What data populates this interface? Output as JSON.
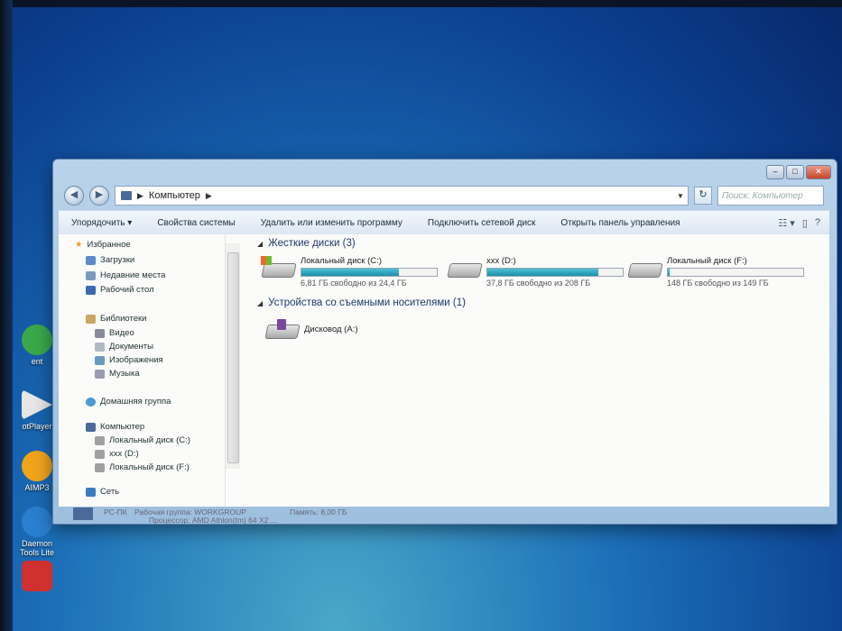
{
  "desktop_icons": [
    {
      "label": "ent",
      "color": "#3aa84a"
    },
    {
      "label": "otPlayer",
      "color": "#e8e8e8"
    },
    {
      "label": "AIMP3",
      "color": "#f0a41a"
    },
    {
      "label": "Daemon Tools Lite",
      "color": "#2a7fd0"
    },
    {
      "label": "",
      "color": "#d03030"
    }
  ],
  "window": {
    "address": {
      "root": "Компьютер"
    },
    "search_placeholder": "Поиск: Компьютер",
    "toolbar": {
      "organize": "Упорядочить ▾",
      "system_properties": "Свойства системы",
      "uninstall": "Удалить или изменить программу",
      "map_drive": "Подключить сетевой диск",
      "control_panel": "Открыть панель управления"
    },
    "nav": {
      "favorites": "Избранное",
      "downloads": "Загрузки",
      "recent": "Недавние места",
      "desktop": "Рабочий стол",
      "libraries": "Библиотеки",
      "video": "Видео",
      "documents": "Документы",
      "pictures": "Изображения",
      "music": "Музыка",
      "homegroup": "Домашняя группа",
      "computer": "Компьютер",
      "drive_c": "Локальный диск (C:)",
      "drive_d": "xxx (D:)",
      "drive_f": "Локальный диск (F:)",
      "network": "Сеть"
    },
    "groups": {
      "hard_disks": "Жесткие диски (3)",
      "removable": "Устройства со съемными носителями (1)"
    },
    "drives": [
      {
        "name": "Локальный диск (C:)",
        "free": "6,81 ГБ свободно из 24,4 ГБ",
        "used_fraction": 0.72
      },
      {
        "name": "xxx (D:)",
        "free": "37,8 ГБ свободно из 208 ГБ",
        "used_fraction": 0.82
      },
      {
        "name": "Локальный диск (F:)",
        "free": "148 ГБ свободно из 149 ГБ",
        "used_fraction": 0.01
      }
    ],
    "removable_drive": {
      "name": "Дисковод (A:)"
    },
    "details": {
      "pc_name": "PC-ПК",
      "workgroup": "Рабочая группа: WORKGROUP",
      "memory": "Память: 8,00 ГБ",
      "processor": "Процессор: AMD Athlon(tm) 64 X2 ..."
    }
  }
}
